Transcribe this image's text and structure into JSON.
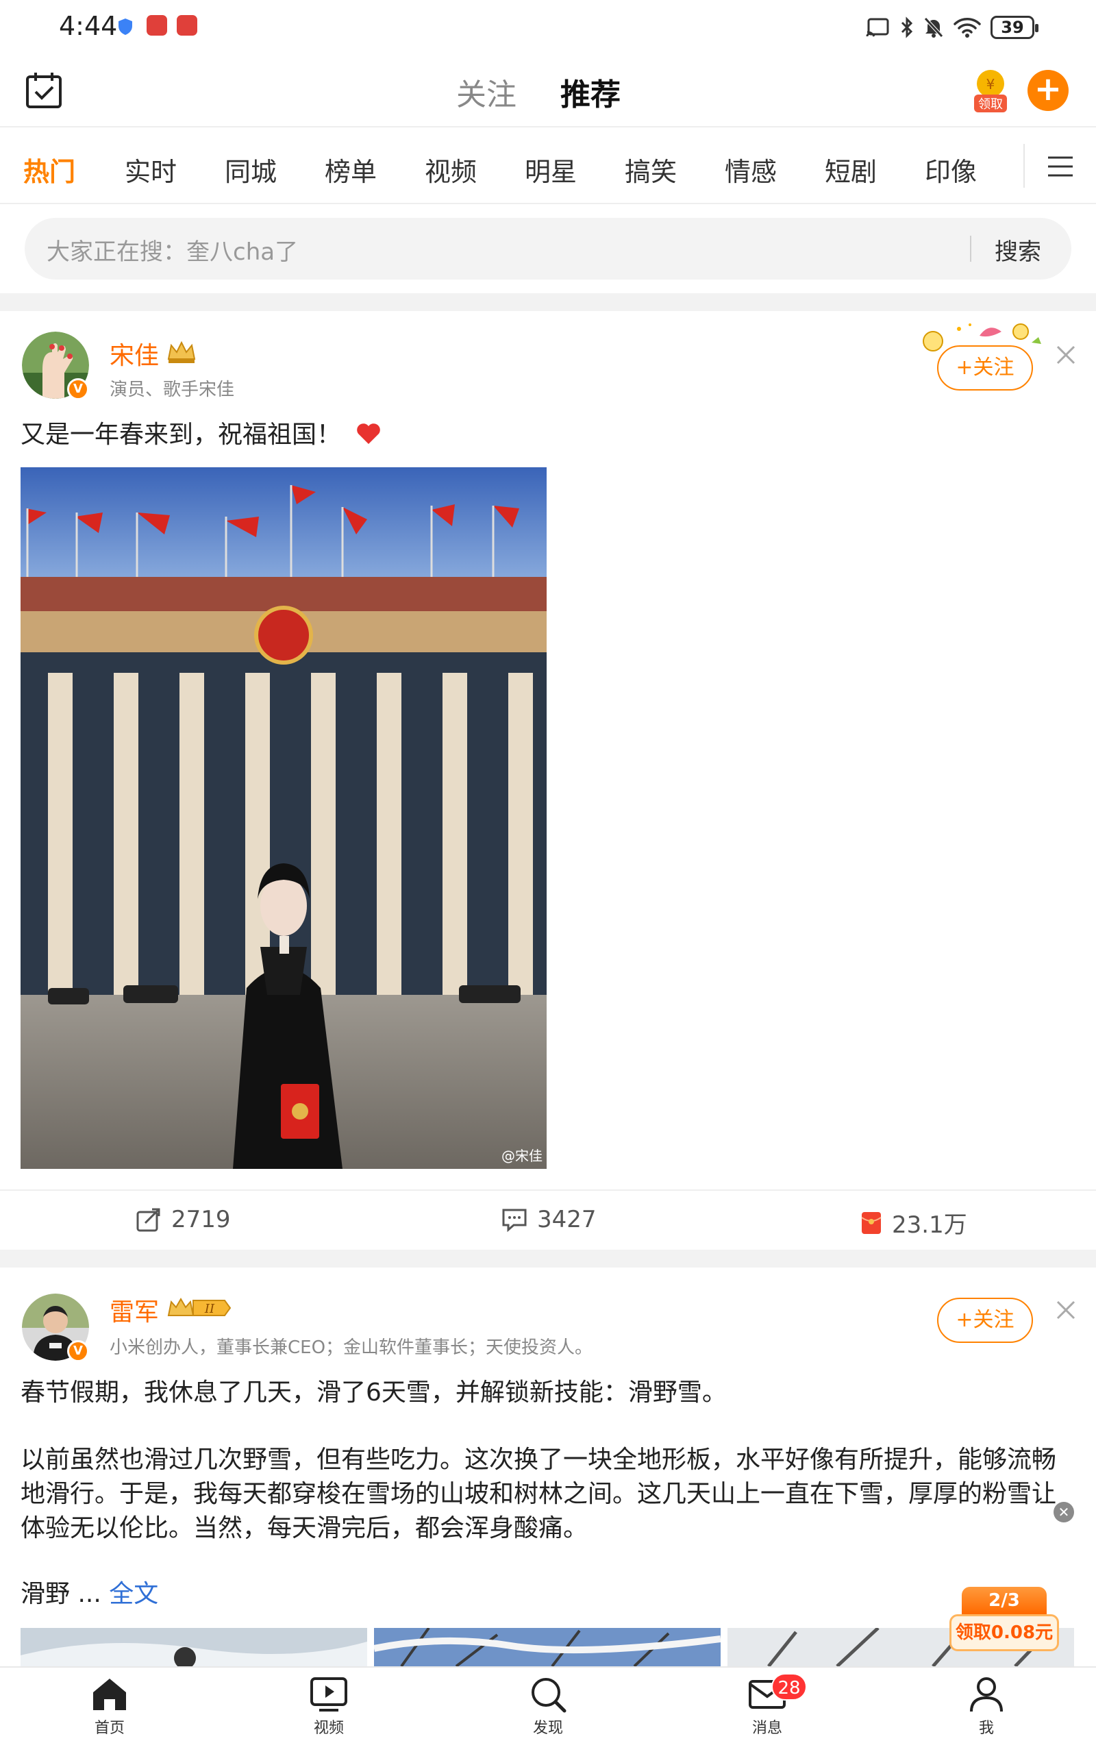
{
  "status_bar": {
    "time": "4:44",
    "battery": "39"
  },
  "header": {
    "tabs": [
      {
        "label": "关注"
      },
      {
        "label": "推荐"
      }
    ],
    "coin_label": "领取",
    "plus_label": "+"
  },
  "channels": [
    "热门",
    "实时",
    "同城",
    "榜单",
    "视频",
    "明星",
    "搞笑",
    "情感",
    "短剧",
    "印像"
  ],
  "search": {
    "placeholder": "大家正在搜：奎八cha了",
    "button": "搜索"
  },
  "posts": [
    {
      "author": "宋佳",
      "description": "演员、歌手宋佳",
      "follow_label": "+关注",
      "text": "又是一年春来到，祝福祖国！",
      "watermark": "@宋佳",
      "stats": {
        "reposts": "2719",
        "comments": "3427",
        "likes": "23.1万"
      }
    },
    {
      "author": "雷军",
      "description": "小米创办人，董事长兼CEO；金山软件董事长；天使投资人。",
      "follow_label": "+关注",
      "paragraphs": [
        "春节假期，我休息了几天，滑了6天雪，并解锁新技能：滑野雪。",
        "以前虽然也滑过几次野雪，但有些吃力。这次换了一块全地形板，水平好像有所提升，能够流畅地滑行。于是，我每天都穿梭在雪场的山坡和树林之间。这几天山上一直在下雪，厚厚的粉雪让体验无以伦比。当然，每天滑完后，都会浑身酸痛。",
        "滑野 ..."
      ],
      "more_label": "全文"
    }
  ],
  "reward": {
    "progress": "2/3",
    "label": "领取0.08元"
  },
  "bottom_nav": [
    {
      "label": "首页"
    },
    {
      "label": "视频"
    },
    {
      "label": "发现"
    },
    {
      "label": "消息",
      "badge": "28"
    },
    {
      "label": "我"
    }
  ],
  "colors": {
    "accent": "#ff8200",
    "link": "#2f6fd6",
    "badge": "#ff3333"
  }
}
